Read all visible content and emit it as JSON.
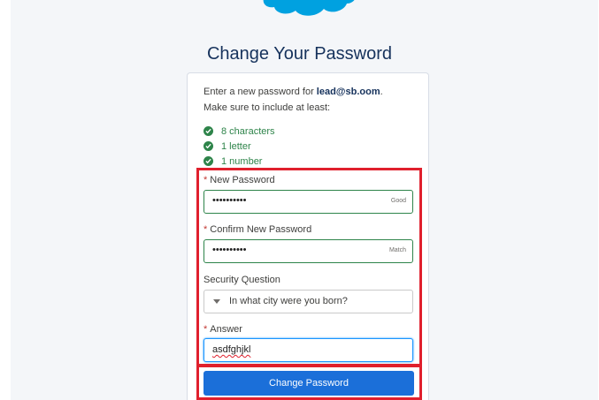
{
  "title": "Change Your Password",
  "intro": {
    "line1_prefix": "Enter a new password for ",
    "email": "lead@sb.oom",
    "line1_suffix": ".",
    "line2": "Make sure to include at least:"
  },
  "requirements": [
    "8 characters",
    "1 letter",
    "1 number"
  ],
  "new_password": {
    "label": "New Password",
    "value": "••••••••••",
    "hint": "Good"
  },
  "confirm_password": {
    "label": "Confirm New Password",
    "value": "••••••••••",
    "hint": "Match"
  },
  "security_question": {
    "label": "Security Question",
    "selected": "In what city were you born?"
  },
  "answer": {
    "label": "Answer",
    "value": "asdfghjkl"
  },
  "submit_label": "Change Password",
  "colors": {
    "accent": "#1b6fd9",
    "success": "#2e844a",
    "highlight": "#e0202d",
    "title": "#16325c"
  },
  "icons": {
    "logo": "salesforce-cloud-logo",
    "requirement": "check-circle-icon",
    "select": "chevron-down-icon"
  }
}
